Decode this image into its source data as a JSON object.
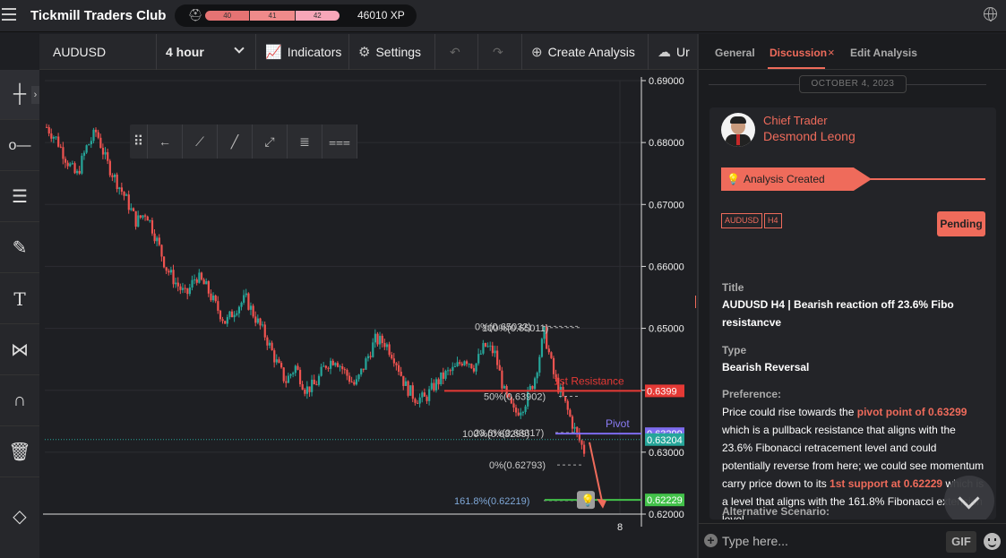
{
  "app": {
    "brand": "Tickmill Traders Club",
    "xp_levels": [
      "40",
      "41",
      "42"
    ],
    "xp_total": "46010 XP"
  },
  "toolbar": {
    "symbol": "AUDUSD",
    "timeframe": "4 hour",
    "indicators": "Indicators",
    "settings": "Settings",
    "create_analysis": "Create Analysis",
    "upload_partial": "Ur"
  },
  "left_tools": [
    "crosshair-icon",
    "horizontal-line-icon",
    "channel-lines-icon",
    "brush-icon",
    "text-icon",
    "pattern-icon",
    "magnet-icon",
    "trash-icon",
    "layers-icon"
  ],
  "chart_data": {
    "type": "candlestick",
    "symbol": "AUDUSD",
    "timeframe": "4 hour",
    "y_ticks": [
      "0.69000",
      "0.68000",
      "0.67000",
      "0.66000",
      "0.65000",
      "0.64000",
      "0.63000",
      "0.62000"
    ],
    "ylim": [
      0.62,
      0.69
    ],
    "x_tick": "8",
    "price_path": [
      0.6825,
      0.6805,
      0.6772,
      0.6745,
      0.6792,
      0.6818,
      0.6769,
      0.6738,
      0.6708,
      0.6672,
      0.6688,
      0.6645,
      0.6598,
      0.6573,
      0.6552,
      0.6585,
      0.6567,
      0.6536,
      0.6509,
      0.6533,
      0.6548,
      0.6516,
      0.6487,
      0.6448,
      0.6414,
      0.6438,
      0.6401,
      0.6409,
      0.6441,
      0.6452,
      0.6428,
      0.6407,
      0.6444,
      0.6481,
      0.6477,
      0.6452,
      0.6408,
      0.6388,
      0.6386,
      0.6409,
      0.6425,
      0.6434,
      0.6453,
      0.6438,
      0.6472,
      0.6461,
      0.6395,
      0.6362,
      0.6378,
      0.6418,
      0.6493,
      0.6421,
      0.6382,
      0.6338,
      0.6302
    ],
    "fib_levels": [
      {
        "label": "0%(0.65032)",
        "value": 0.65032
      },
      {
        "label": "100%(0.65011)",
        "value": 0.65011
      },
      {
        "label": "50%(0.63902)",
        "value": 0.63902
      },
      {
        "label": "23.6%(0.63317)",
        "value": 0.63317
      },
      {
        "label": "100%(0.63299)",
        "value": 0.63299
      },
      {
        "label": "0%(0.62793)",
        "value": 0.62793
      },
      {
        "label": "161.8%(0.62219)",
        "value": 0.62219
      }
    ],
    "lines": [
      {
        "label": "1st Resistance",
        "value": 0.6399,
        "badge": "0.6399",
        "color": "#e53935"
      },
      {
        "label": "Pivot",
        "value": 0.63299,
        "badge": "0.63299",
        "color": "#7e6cf0"
      },
      {
        "label": "",
        "value": 0.62229,
        "badge": "0.62229",
        "color": "#43c24a"
      }
    ],
    "current_price": "0.63204",
    "colors": {
      "up": "#26a69a",
      "down": "#ef5350"
    }
  },
  "panel": {
    "tabs": [
      "General",
      "Discussion",
      "Edit Analysis"
    ],
    "active_tab": "Discussion",
    "date": "OCTOBER 4, 2023",
    "author_role": "Chief Trader",
    "author_name": "Desmond Leong",
    "event": "Analysis Created",
    "tags": [
      "AUDUSD",
      "H4"
    ],
    "status": "Pending",
    "title_label": "Title",
    "title_value": "AUDUSD H4 | Bearish reaction off 23.6% Fibo resistancve",
    "type_label": "Type",
    "type_value": "Bearish Reversal",
    "preference_label": "Preference:",
    "pref_1": "Price could rise towards the ",
    "pref_hl_1": "pivot point of 0.63299",
    "pref_2": " which is a pullback resistance that aligns with the 23.6% Fibonacci retracement level and could potentially reverse from here; we could see momentum carry price down to its ",
    "pref_hl_2": "1st support at 0.62229",
    "pref_3": " which is a level that aligns with the 161.8% Fibonacci extension level.",
    "alt_label": "Alternative Scenario:",
    "input_placeholder": "Type here...",
    "gif": "GIF"
  }
}
